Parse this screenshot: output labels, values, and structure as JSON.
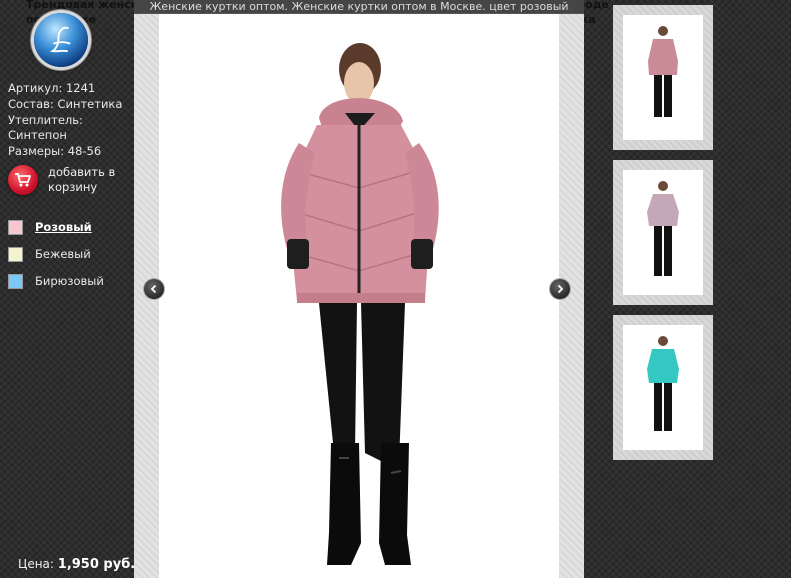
{
  "description": {
    "line1_left": "Трендовая женск",
    "line1_right": "Моде",
    "line2_left": "по     вная же",
    "line2_right": "ыска"
  },
  "logo": {
    "icon": "script-l-monogram-icon"
  },
  "specs": {
    "article": "Артикул: 1241",
    "composition": "Состав: Синтетика",
    "insulation_label": "Утеплитель:",
    "insulation_value": "Синтепон",
    "sizes": "Размеры: 48-56"
  },
  "cart": {
    "label": "добавить в корзину",
    "icon": "shopping-cart-icon"
  },
  "colors": [
    {
      "label": "Розовый",
      "swatch": "#f6c7cd",
      "active": true
    },
    {
      "label": "Бежевый",
      "swatch": "#f4f3cf",
      "active": false
    },
    {
      "label": "Бирюзовый",
      "swatch": "#7cc8f4",
      "active": false
    }
  ],
  "price": {
    "label": "Цена:",
    "value": "1,950 руб."
  },
  "viewer": {
    "caption": "Женские куртки оптом. Женские куртки оптом в Москве. цвет розовый",
    "prev_icon": "chevron-left-icon",
    "next_icon": "chevron-right-icon"
  },
  "thumbnails": [
    {
      "jacket_color": "#c98c97"
    },
    {
      "jacket_color": "#c4a8b7"
    },
    {
      "jacket_color": "#35c7c2"
    }
  ],
  "theme": {
    "jacket_main": "#d4919d"
  }
}
